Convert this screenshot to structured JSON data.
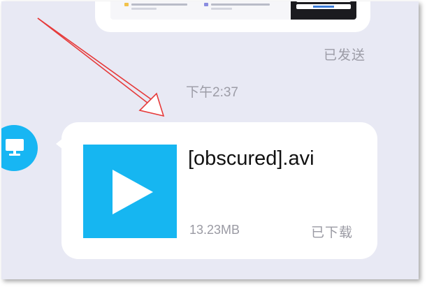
{
  "chat": {
    "previous_message": {
      "status": "已发送"
    },
    "time_divider": "下午2:37",
    "file_message": {
      "file_name": "[obscured].avi",
      "file_size": "13.23MB",
      "status": "已下载",
      "thumbnail_icon": "play-icon",
      "thumbnail_color": "#16b6f1"
    },
    "sender_avatar": {
      "icon": "desktop-computer-icon",
      "color": "#17b6f3"
    },
    "annotation": {
      "type": "red-arrow",
      "color": "#e63a3a"
    }
  }
}
